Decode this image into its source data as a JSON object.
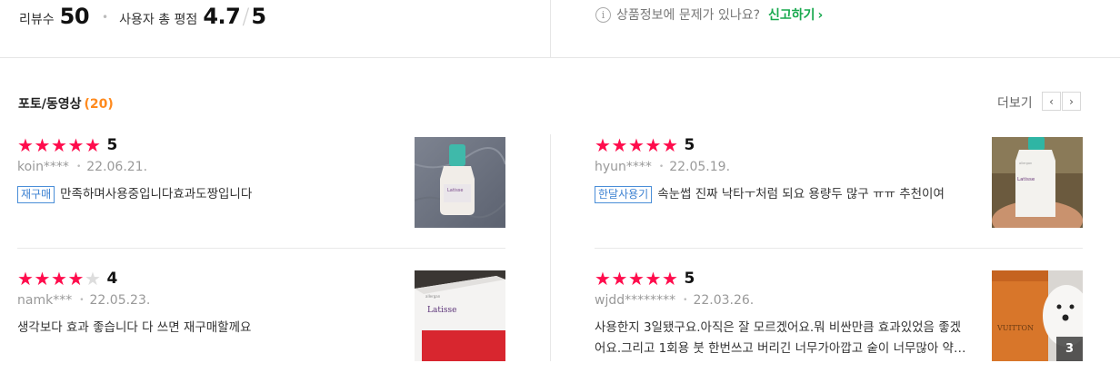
{
  "summary": {
    "review_count_label": "리뷰수",
    "review_count": "50",
    "bullet": "•",
    "rating_label": "사용자 총 평점",
    "rating": "4.7",
    "rating_sep": "/",
    "rating_max": "5",
    "info_icon": "i",
    "report_question": "상품정보에 문제가 있나요?",
    "report_link": "신고하기",
    "report_chevron": "›"
  },
  "photo_section": {
    "title": "포토/동영상",
    "count": "(20)",
    "more_label": "더보기",
    "prev_arrow": "‹",
    "next_arrow": "›"
  },
  "reviews": [
    {
      "rating": 5,
      "score": "5",
      "user": "koin****",
      "sep": "•",
      "date": "22.06.21.",
      "tag": "재구매",
      "text": "만족하며사용중입니다효과도짱입니다",
      "photo_count": ""
    },
    {
      "rating": 5,
      "score": "5",
      "user": "hyun****",
      "sep": "•",
      "date": "22.05.19.",
      "tag": "한달사용기",
      "text": "속눈썹 진짜 낙타ㅜ처럼 되요 용량두 많구 ㅠㅠ 추천이여",
      "photo_count": ""
    },
    {
      "rating": 4,
      "score": "4",
      "user": "namk***",
      "sep": "•",
      "date": "22.05.23.",
      "tag": "",
      "text": "생각보다 효과 좋습니다 다 쓰면 재구매할께요",
      "photo_count": ""
    },
    {
      "rating": 5,
      "score": "5",
      "user": "wjdd********",
      "sep": "•",
      "date": "22.03.26.",
      "tag": "",
      "text_line1": "사용한지 3일됐구요.아직은 잘 모르겠어요.뭐 비싼만큼 효과있었음 좋겠",
      "text_line2": "어요.그리고 1회용 붓 한번쓰고 버리긴 너무가아깝고 숱이 너무많아 약…",
      "photo_count": "3"
    }
  ],
  "thumbnail_labels": {
    "bottle": "Latisse",
    "box": "Latisse",
    "box_brand": "VUITTON",
    "allergan": "allergan"
  },
  "star_glyph": "★"
}
